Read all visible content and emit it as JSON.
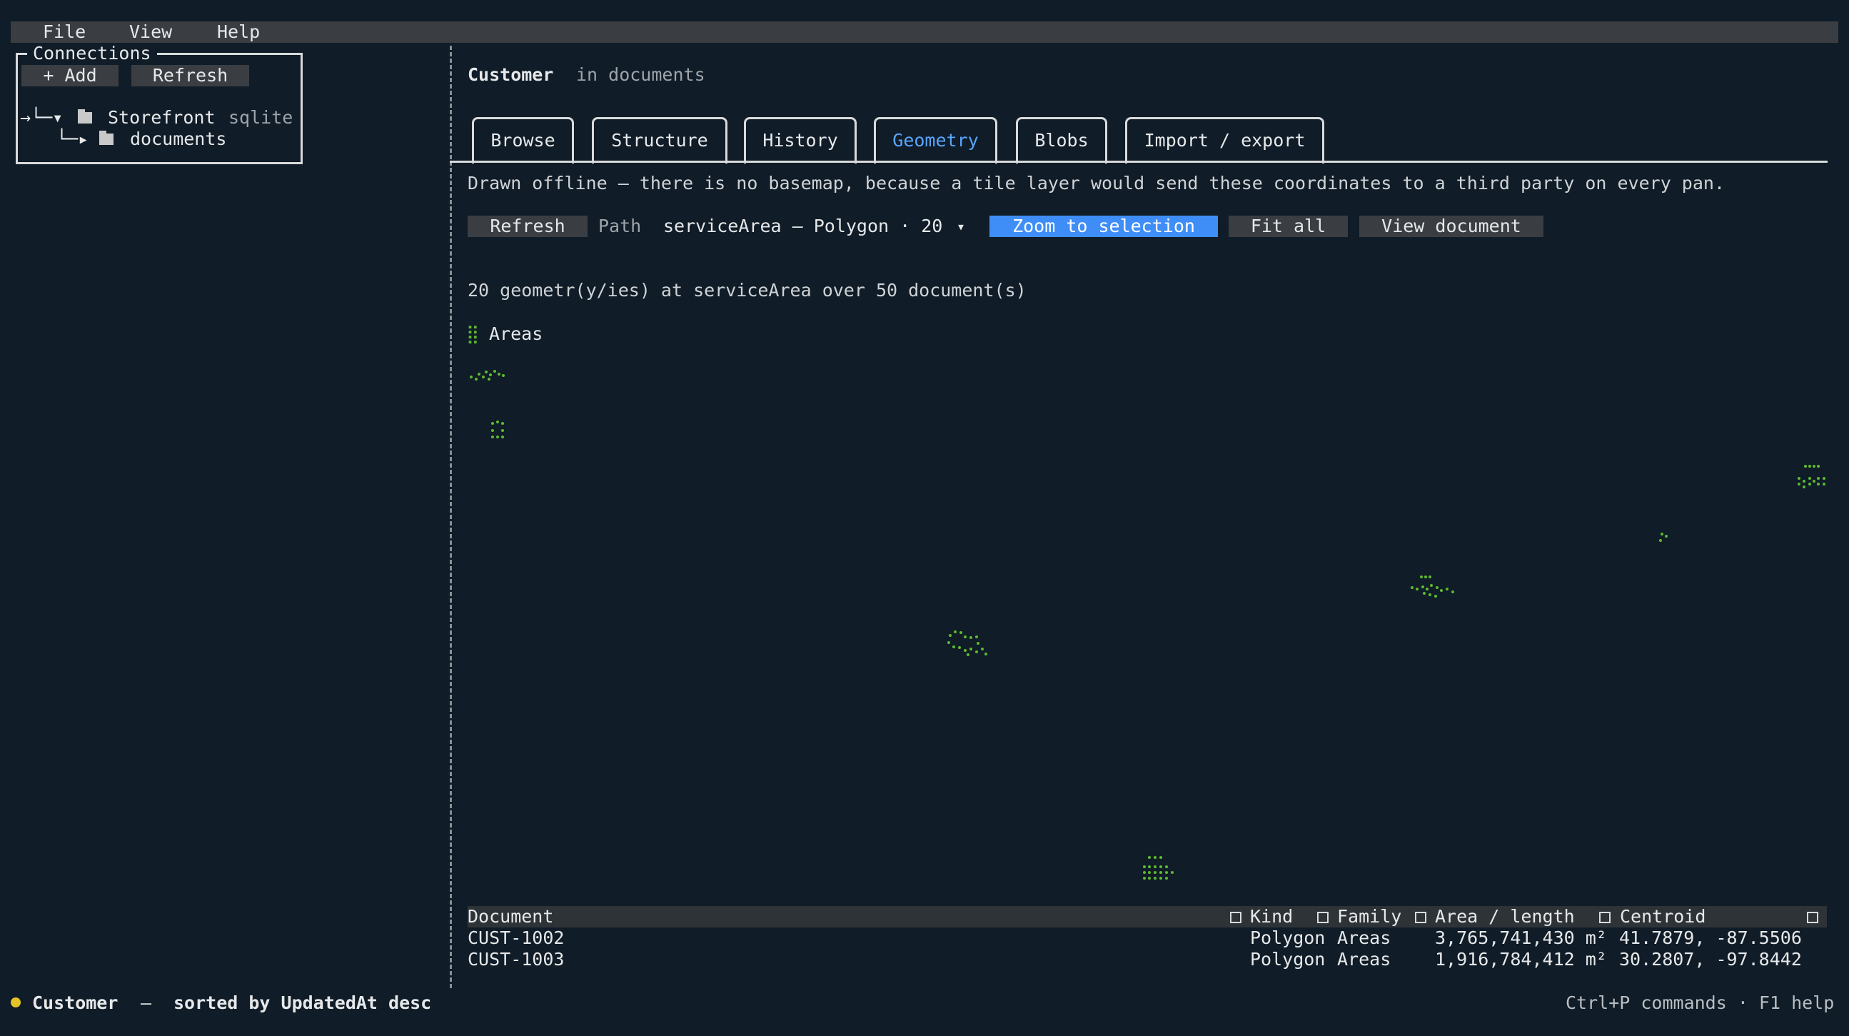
{
  "menu": {
    "file": "File",
    "view": "View",
    "help": "Help"
  },
  "connections": {
    "title": "Connections",
    "add_label": "+ Add",
    "refresh_label": "Refresh",
    "tree_prefix_root": "→└─▾",
    "root_name": "Storefront",
    "root_kind": "sqlite",
    "tree_prefix_child": "└─▸",
    "child_name": "documents"
  },
  "header": {
    "collection": "Customer",
    "context": "in documents"
  },
  "tabs": [
    "Browse",
    "Structure",
    "History",
    "Geometry",
    "Blobs",
    "Import / export"
  ],
  "active_tab": "Geometry",
  "notice": "Drawn offline — there is no basemap, because a tile layer would send these coordinates to a third party on every pan.",
  "toolbar": {
    "refresh_label": "Refresh",
    "path_label": "Path",
    "path_value": "serviceArea — Polygon · 20",
    "dropdown_icon": "▾",
    "zoom_label": "Zoom to selection",
    "fit_label": "Fit all",
    "view_doc_label": "View document"
  },
  "summary": "20 geometr(y/ies) at serviceArea over 50 document(s)",
  "legend": {
    "icon": "⣿",
    "label": "Areas",
    "color": "#5dbb2f"
  },
  "table": {
    "headers": [
      "Document",
      "Kind",
      "Family",
      "Area / length",
      "Centroid"
    ],
    "rows": [
      [
        "CUST-1002",
        "Polygon",
        "Areas",
        "3,765,741,430 m²",
        "41.7879, -87.5506"
      ],
      [
        "CUST-1003",
        "Polygon",
        "Areas",
        "1,916,784,412 m²",
        "30.2807, -97.8442"
      ]
    ]
  },
  "status": {
    "collection": "Customer",
    "separator": "—",
    "sort": "sorted by UpdatedAt desc",
    "hint": "Ctrl+P commands · F1 help"
  },
  "colors": {
    "accent": "#3f8ef7",
    "active_tab": "#58a6ff",
    "geometry": "#5dbb2f",
    "status_dot": "#e6c229"
  }
}
